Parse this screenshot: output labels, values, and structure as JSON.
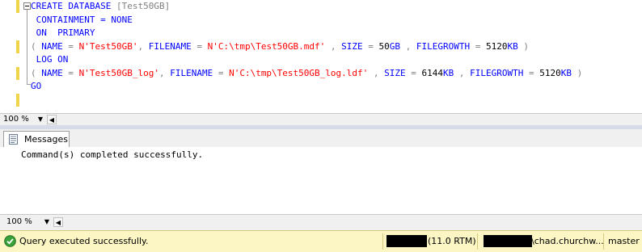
{
  "editor": {
    "lines": [
      {
        "tokens": [
          {
            "t": "CREATE DATABASE ",
            "c": "kw"
          },
          {
            "t": "[Test50GB]",
            "c": "ob"
          }
        ]
      },
      {
        "tokens": [
          {
            "t": " CONTAINMENT = NONE",
            "c": "kw"
          }
        ]
      },
      {
        "tokens": [
          {
            "t": " ON  PRIMARY",
            "c": "kw"
          }
        ]
      },
      {
        "tokens": [
          {
            "t": "( ",
            "c": "gray"
          },
          {
            "t": "NAME",
            "c": "kw"
          },
          {
            "t": " = ",
            "c": "gray"
          },
          {
            "t": "N'Test50GB'",
            "c": "str"
          },
          {
            "t": ", ",
            "c": "gray"
          },
          {
            "t": "FILENAME",
            "c": "kw"
          },
          {
            "t": " = ",
            "c": "gray"
          },
          {
            "t": "N'C:\\tmp\\Test50GB.mdf'",
            "c": "str"
          },
          {
            "t": " , ",
            "c": "gray"
          },
          {
            "t": "SIZE",
            "c": "kw"
          },
          {
            "t": " = ",
            "c": "gray"
          },
          {
            "t": "50",
            "c": ""
          },
          {
            "t": "GB",
            "c": "kw"
          },
          {
            "t": " , ",
            "c": "gray"
          },
          {
            "t": "FILEGROWTH",
            "c": "kw"
          },
          {
            "t": " = ",
            "c": "gray"
          },
          {
            "t": "5120",
            "c": ""
          },
          {
            "t": "KB",
            "c": "kw"
          },
          {
            "t": " )",
            "c": "gray"
          }
        ]
      },
      {
        "tokens": [
          {
            "t": " LOG ON",
            "c": "kw"
          }
        ]
      },
      {
        "tokens": [
          {
            "t": "( ",
            "c": "gray"
          },
          {
            "t": "NAME",
            "c": "kw"
          },
          {
            "t": " = ",
            "c": "gray"
          },
          {
            "t": "N'Test50GB_log'",
            "c": "str"
          },
          {
            "t": ", ",
            "c": "gray"
          },
          {
            "t": "FILENAME",
            "c": "kw"
          },
          {
            "t": " = ",
            "c": "gray"
          },
          {
            "t": "N'C:\\tmp\\Test50GB_log.ldf'",
            "c": "str"
          },
          {
            "t": " , ",
            "c": "gray"
          },
          {
            "t": "SIZE",
            "c": "kw"
          },
          {
            "t": " = ",
            "c": "gray"
          },
          {
            "t": "6144",
            "c": ""
          },
          {
            "t": "KB",
            "c": "kw"
          },
          {
            "t": " , ",
            "c": "gray"
          },
          {
            "t": "FILEGROWTH",
            "c": "kw"
          },
          {
            "t": " = ",
            "c": "gray"
          },
          {
            "t": "5120",
            "c": ""
          },
          {
            "t": "KB",
            "c": "kw"
          },
          {
            "t": " )",
            "c": "gray"
          }
        ]
      },
      {
        "tokens": [
          {
            "t": "GO",
            "c": "kw"
          }
        ]
      }
    ],
    "change_marks": [
      true,
      false,
      false,
      true,
      false,
      true,
      false,
      true
    ],
    "zoom": "100 %",
    "colors": {
      "keyword": "#0000ff",
      "string": "#ff0000",
      "operator": "#808080",
      "change_mark": "#f0d44a"
    }
  },
  "results": {
    "tab_label": "Messages",
    "tab_icon": "messages-icon",
    "message": "Command(s) completed successfully.",
    "zoom": "100 %"
  },
  "status": {
    "icon": "success-check-icon",
    "text": "Query executed successfully.",
    "server_version": "(11.0 RTM)",
    "user": "\\chad.churchw...",
    "database": "master",
    "background": "#fbf6c4"
  }
}
